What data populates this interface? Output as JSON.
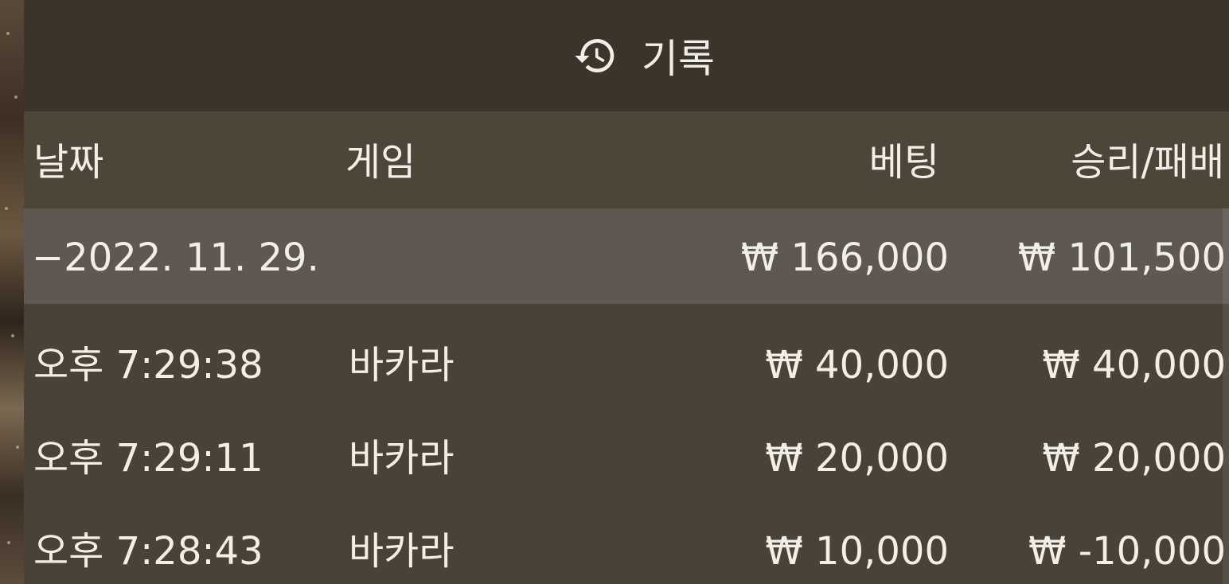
{
  "title": {
    "icon": "history-icon",
    "label": "기록"
  },
  "columns": {
    "date": "날짜",
    "game": "게임",
    "bet": "베팅",
    "result": "승리/패배"
  },
  "summary": {
    "date": "−2022. 11. 29.",
    "bet": "₩ 166,000",
    "result": "₩ 101,500"
  },
  "rows": [
    {
      "time": "오후 7:29:38",
      "game": "바카라",
      "bet": "₩ 40,000",
      "result": "₩ 40,000"
    },
    {
      "time": "오후 7:29:11",
      "game": "바카라",
      "bet": "₩ 20,000",
      "result": "₩ 20,000"
    },
    {
      "time": "오후 7:28:43",
      "game": "바카라",
      "bet": "₩ 10,000",
      "result": "₩ -10,000"
    }
  ],
  "colors": {
    "title_bar": "#3b342b",
    "panel": "#4a4237",
    "summary_row": "#5f5850",
    "text": "#f2efe9"
  }
}
